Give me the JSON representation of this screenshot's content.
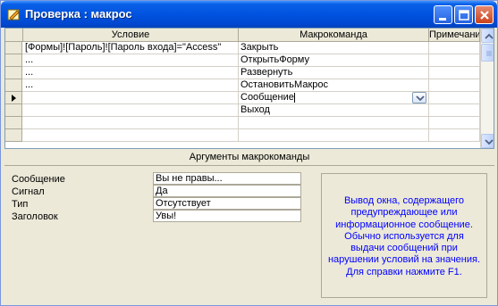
{
  "window": {
    "title": "Проверка : макрос",
    "icon": "macro-icon"
  },
  "grid": {
    "columns": [
      "Условие",
      "Макрокоманда",
      "Примечание"
    ],
    "rows": [
      {
        "condition": "[Формы]![Пароль]![Пароль входа]=\"Access\"",
        "action": "Закрыть",
        "note": ""
      },
      {
        "condition": "...",
        "action": "ОткрытьФорму",
        "note": ""
      },
      {
        "condition": "...",
        "action": "Развернуть",
        "note": ""
      },
      {
        "condition": "...",
        "action": "ОстановитьМакрос",
        "note": ""
      },
      {
        "condition": "",
        "action": "Сообщение",
        "note": "",
        "current": true
      },
      {
        "condition": "",
        "action": "Выход",
        "note": ""
      },
      {
        "condition": "",
        "action": "",
        "note": ""
      },
      {
        "condition": "",
        "action": "",
        "note": ""
      }
    ]
  },
  "arguments": {
    "title": "Аргументы макрокоманды",
    "properties": [
      {
        "label": "Сообщение",
        "value": "Вы не правы..."
      },
      {
        "label": "Сигнал",
        "value": "Да"
      },
      {
        "label": "Тип",
        "value": "Отсутствует"
      },
      {
        "label": "Заголовок",
        "value": "Увы!"
      }
    ],
    "help_lines": [
      "Вывод окна, содержащего",
      "предупреждающее или",
      "информационное сообщение.",
      "Обычно используется для",
      "выдачи сообщений при",
      "нарушении условий на значения.",
      "Для справки нажмите F1."
    ]
  },
  "colors": {
    "titlebar": "#0053e0",
    "help_text": "#0000ff",
    "panel_bg": "#ece9d8"
  }
}
